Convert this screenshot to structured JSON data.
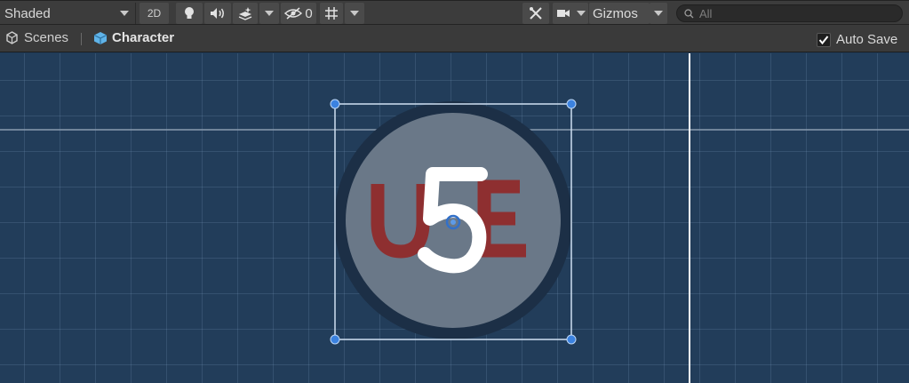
{
  "toolbar": {
    "draw_mode": "Shaded",
    "mode_2d": "2D",
    "hidden_count": "0",
    "gizmos": "Gizmos",
    "search_placeholder": "All",
    "icons": [
      "lightbulb-icon",
      "audio-icon",
      "effects-icon",
      "visibility-icon",
      "grid-icon",
      "tools-icon",
      "camera-icon",
      "search-icon"
    ]
  },
  "breadcrumb": {
    "scenes": "Scenes",
    "current": "Character"
  },
  "auto_save": {
    "label": "Auto Save",
    "checked": true
  },
  "sprite": {
    "label": "U5E",
    "colors": {
      "circle": "#6a7888",
      "ring": "#1c2f46",
      "letters": "#8e2f30",
      "five": "#ffffff",
      "selection": "#cfe0f2",
      "handle": "#3b82e0",
      "pivot": "#3270c8"
    }
  }
}
